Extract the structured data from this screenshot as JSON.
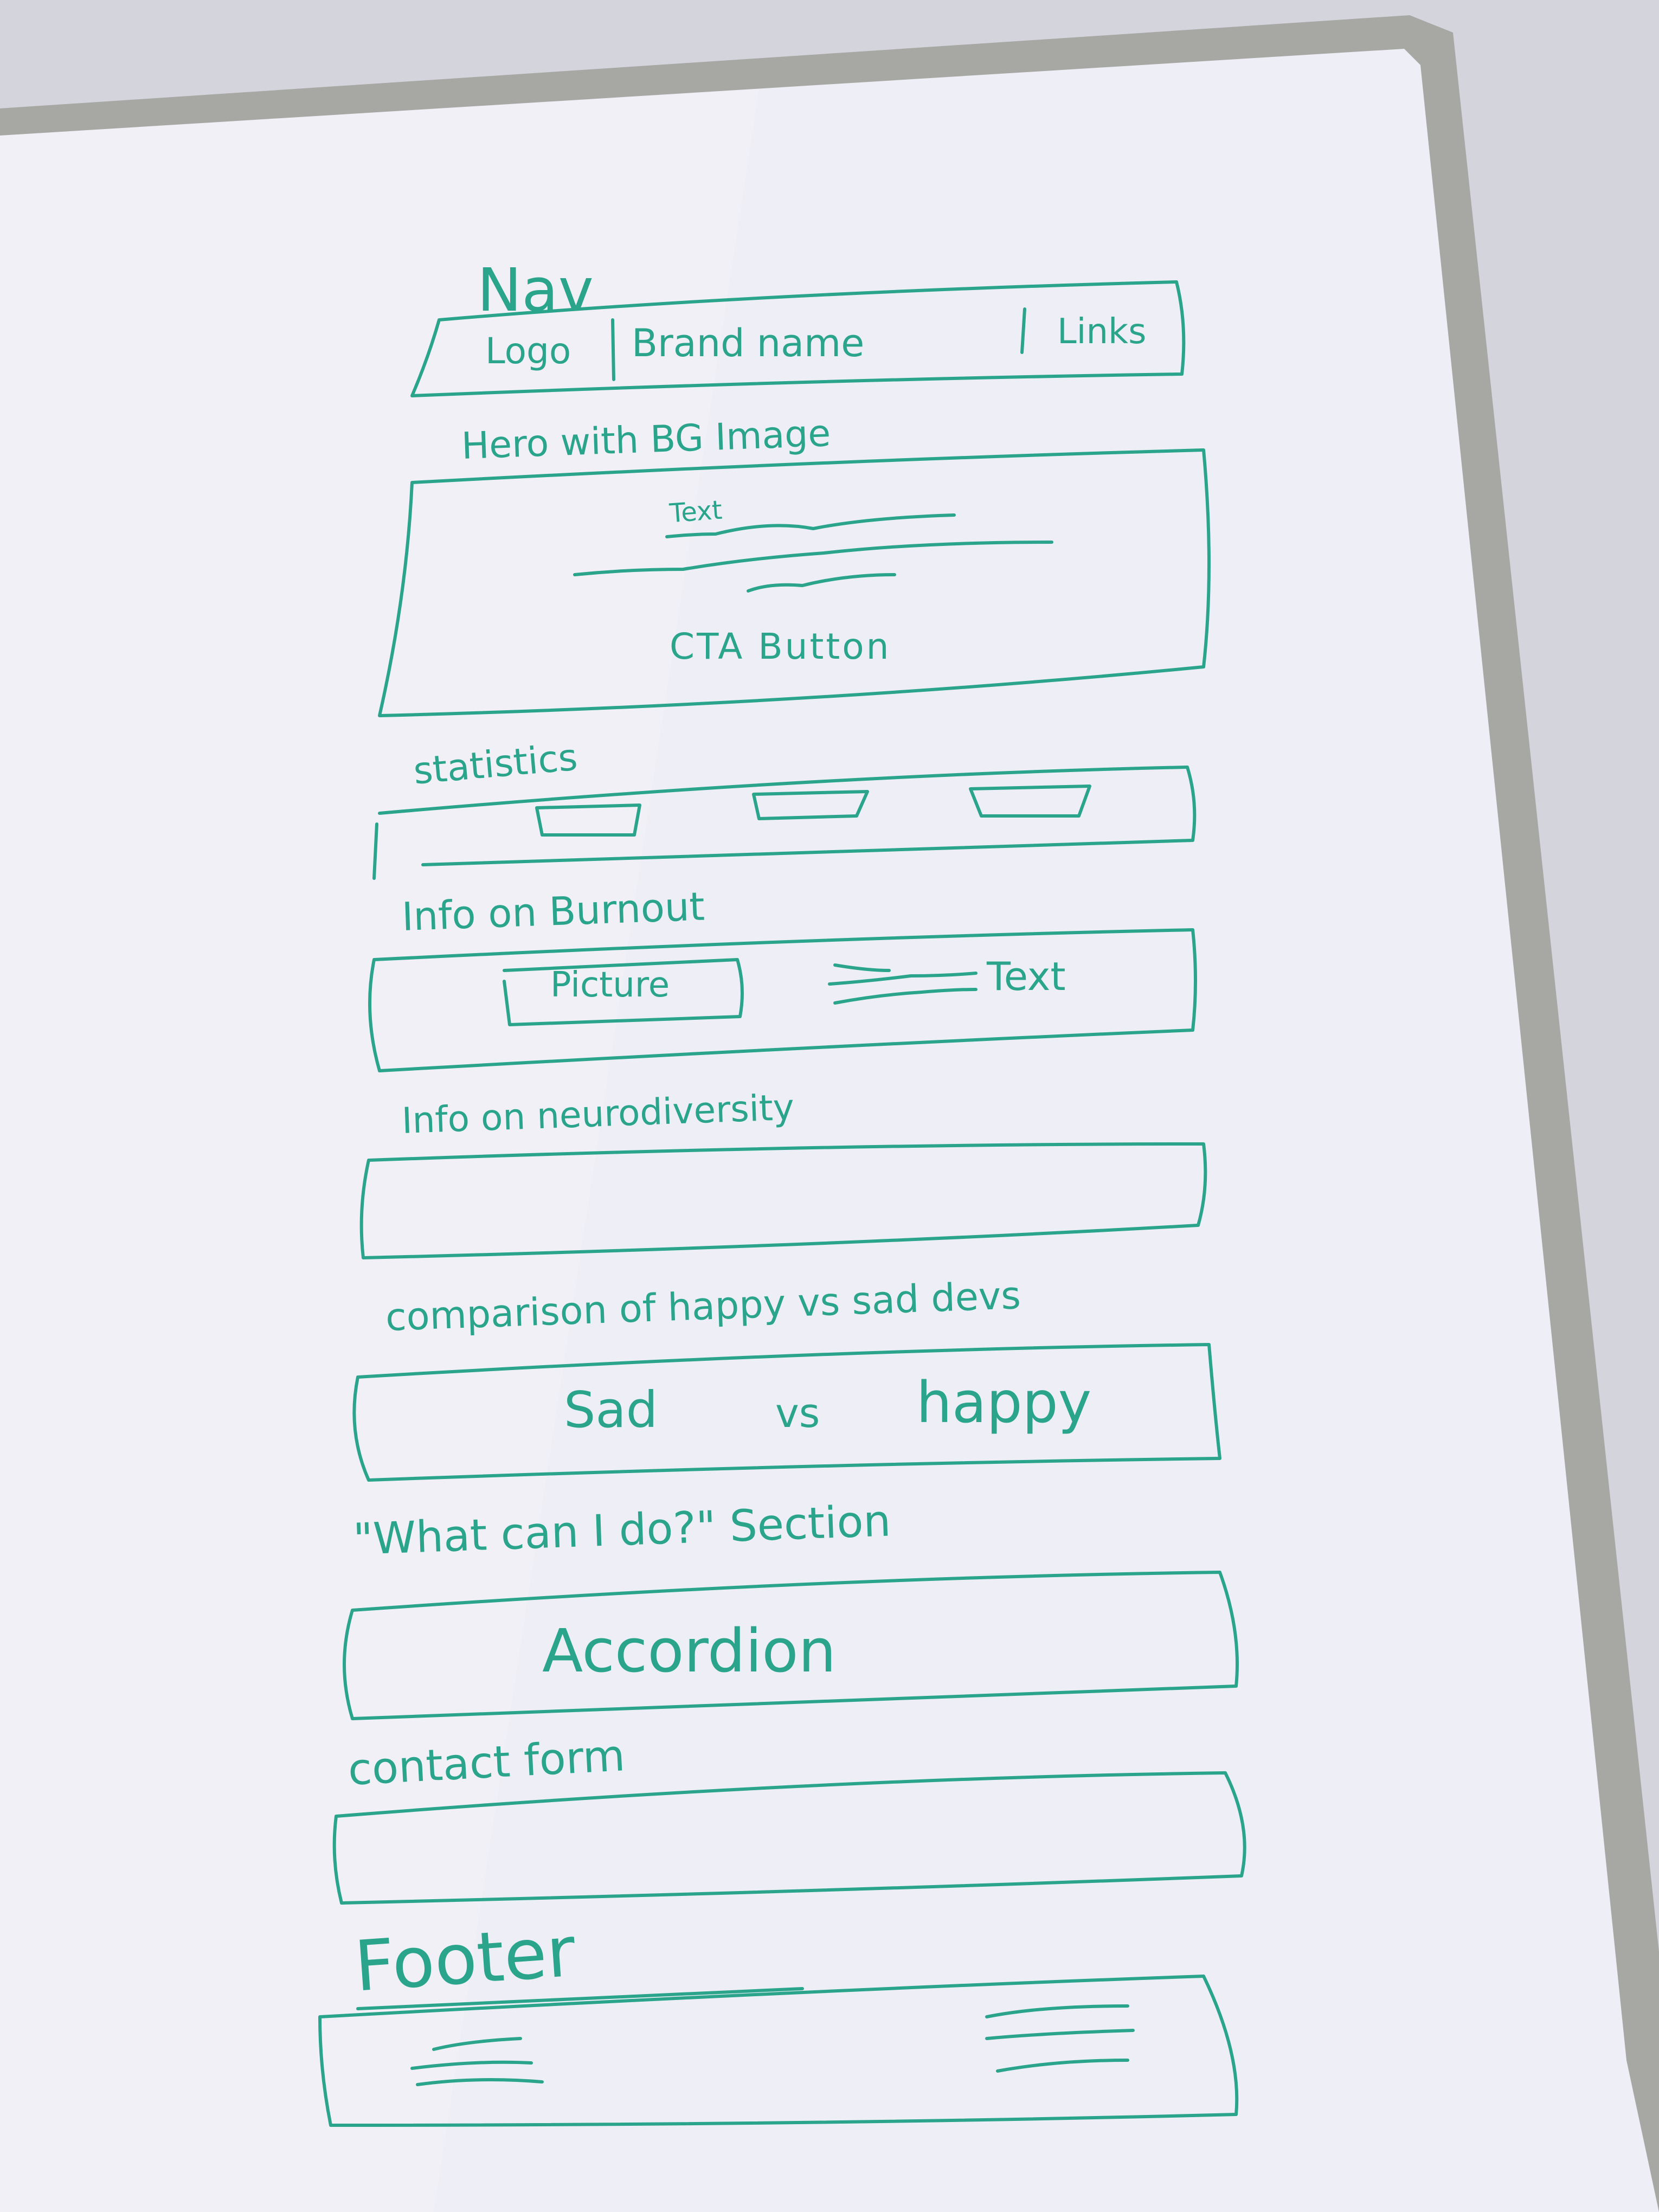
{
  "colors": {
    "ink": "#2aa58c",
    "board": "#eeeef6",
    "frame": "#a9aaa6",
    "wall": "#cfcfd8"
  },
  "whiteboard": {
    "nav": {
      "title": "Nav",
      "logo": "Logo",
      "brand": "Brand name",
      "links": "Links"
    },
    "hero": {
      "title": "Hero with BG Image",
      "text": "Text",
      "cta": "CTA Button"
    },
    "statistics": {
      "title": "statistics"
    },
    "burnout": {
      "title": "Info on Burnout",
      "picture": "Picture",
      "text": "Text"
    },
    "neurodiversity": {
      "title": "Info on neurodiversity"
    },
    "comparison": {
      "title": "comparison of happy vs sad devs",
      "sad": "Sad",
      "vs": "vs",
      "happy": "happy"
    },
    "what_can_i_do": {
      "title": "\"What can I do?\" Section",
      "accordion": "Accordion"
    },
    "contact": {
      "title": "contact form"
    },
    "footer": {
      "title": "Footer"
    }
  }
}
